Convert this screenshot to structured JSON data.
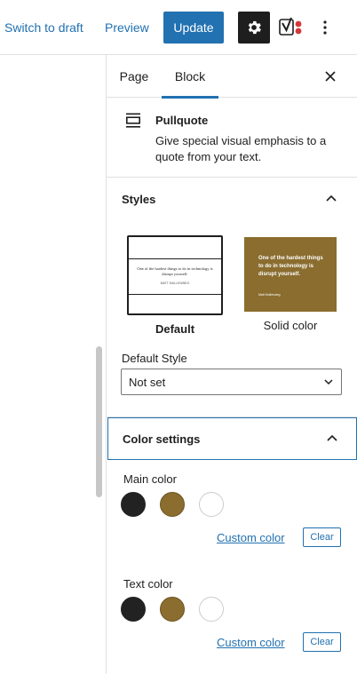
{
  "topbar": {
    "switch_draft": "Switch to draft",
    "preview": "Preview",
    "update": "Update",
    "icons": [
      "gear-icon",
      "yoast-icon",
      "more-vertical-icon"
    ]
  },
  "sidebar": {
    "tabs": [
      {
        "label": "Page"
      },
      {
        "label": "Block"
      }
    ],
    "active_tab": "Block",
    "block": {
      "title": "Pullquote",
      "description": "Give special visual emphasis to a quote from your text."
    },
    "styles": {
      "title": "Styles",
      "options": [
        {
          "label": "Default",
          "preview_text": "One of the hardest things to do in technology is disrupt yourself.",
          "preview_cite": "MATT MULLENWEG",
          "selected": true
        },
        {
          "label": "Solid color",
          "preview_text": "One of the hardest things to do in technology is disrupt yourself.",
          "preview_cite": "Matt Mullenweg",
          "selected": false
        }
      ],
      "default_style_label": "Default Style",
      "default_style_value": "Not set"
    },
    "color_settings": {
      "title": "Color settings",
      "main": {
        "label": "Main color",
        "swatches": [
          "#222222",
          "#8a6d2f",
          "#ffffff"
        ],
        "custom": "Custom color",
        "clear": "Clear"
      },
      "text": {
        "label": "Text color",
        "swatches": [
          "#222222",
          "#8a6d2f",
          "#ffffff"
        ],
        "custom": "Custom color",
        "clear": "Clear"
      }
    }
  },
  "colors": {
    "accent": "#2271b1",
    "dark": "#1e1e1e",
    "brown": "#8a6d2f"
  }
}
